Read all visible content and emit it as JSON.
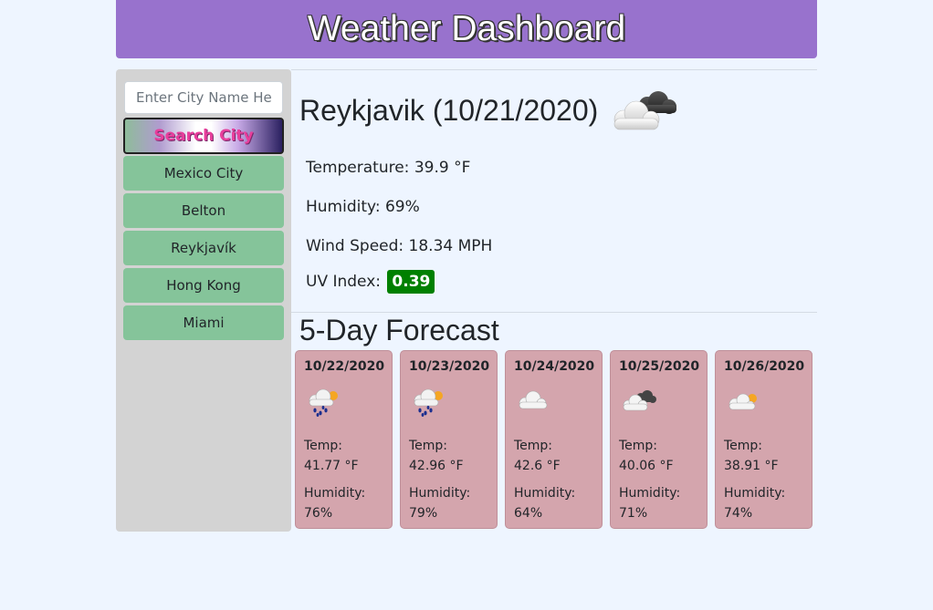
{
  "header": {
    "title": "Weather Dashboard"
  },
  "search": {
    "placeholder": "Enter City Name Here",
    "value": "",
    "button_label": "Search City"
  },
  "history": [
    "Mexico City",
    "Belton",
    "Reykjavík",
    "Hong Kong",
    "Miami"
  ],
  "current": {
    "title": "Reykjavik (10/21/2020)",
    "icon": "overcast-clouds-icon",
    "temperature": "Temperature: 39.9 °F",
    "humidity": "Humidity: 69%",
    "wind": "Wind Speed: 18.34 MPH",
    "uv_label": "UV Index:",
    "uv_value": "0.39",
    "uv_color": "#008000"
  },
  "forecast": {
    "title": "5-Day Forecast",
    "days": [
      {
        "date": "10/22/2020",
        "icon": "rain-sun-icon",
        "temp_label": "Temp:",
        "temp": "41.77 °F",
        "hum_label": "Humidity:",
        "hum": "76%"
      },
      {
        "date": "10/23/2020",
        "icon": "rain-sun-icon",
        "temp_label": "Temp:",
        "temp": "42.96 °F",
        "hum_label": "Humidity:",
        "hum": "79%"
      },
      {
        "date": "10/24/2020",
        "icon": "cloud-icon",
        "temp_label": "Temp:",
        "temp": "42.6 °F",
        "hum_label": "Humidity:",
        "hum": "64%"
      },
      {
        "date": "10/25/2020",
        "icon": "broken-clouds-icon",
        "temp_label": "Temp:",
        "temp": "40.06 °F",
        "hum_label": "Humidity:",
        "hum": "71%"
      },
      {
        "date": "10/26/2020",
        "icon": "cloud-sun-icon",
        "temp_label": "Temp:",
        "temp": "38.91 °F",
        "hum_label": "Humidity:",
        "hum": "74%"
      }
    ]
  }
}
